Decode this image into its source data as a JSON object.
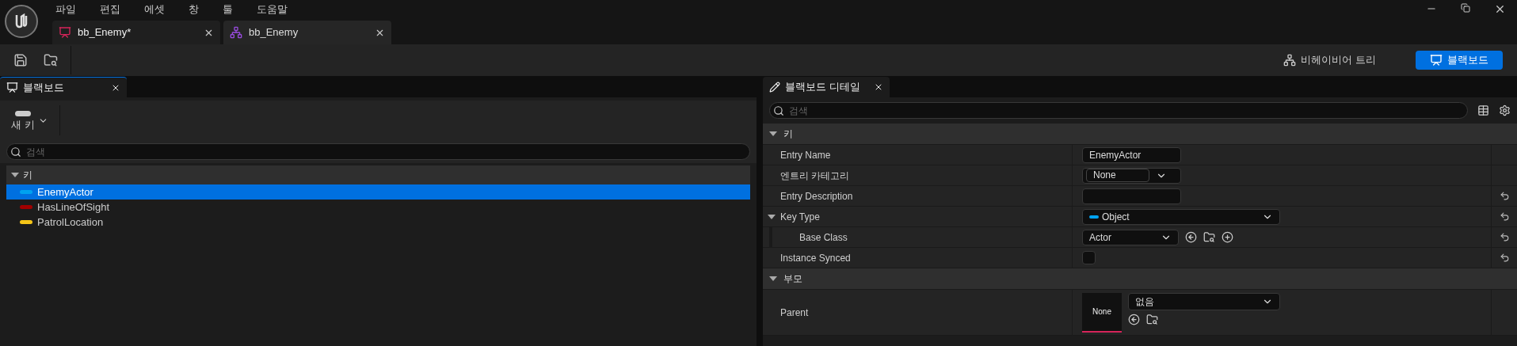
{
  "menu": [
    "파일",
    "편집",
    "에셋",
    "창",
    "툴",
    "도움말"
  ],
  "document_tabs": [
    {
      "label": "bb_Enemy*",
      "kind": "blackboard",
      "selected": true
    },
    {
      "label": "bb_Enemy",
      "kind": "behavior_tree",
      "selected": false
    }
  ],
  "modes": [
    {
      "label": "비헤이비어 트리",
      "kind": "behavior_tree",
      "selected": false
    },
    {
      "label": "블랙보드",
      "kind": "blackboard",
      "selected": true
    }
  ],
  "blackboard_panel": {
    "title": "블랙보드",
    "new_key": "새 키",
    "search": {
      "placeholder": "검색"
    },
    "category": "키",
    "keys": [
      {
        "name": "EnemyActor",
        "color": "#00a2f0",
        "selected": true
      },
      {
        "name": "HasLineOfSight",
        "color": "#a00000",
        "selected": false
      },
      {
        "name": "PatrolLocation",
        "color": "#f5c518",
        "selected": false
      }
    ]
  },
  "details_panel": {
    "title": "블랙보드 디테일",
    "search": {
      "placeholder": "검색"
    },
    "categories": [
      {
        "label": "키",
        "expanded": true,
        "rows": [
          {
            "label": "Entry Name",
            "kind": "text",
            "value": "EnemyActor",
            "reset": false
          },
          {
            "label": "엔트리 카테고리",
            "kind": "combo",
            "value": "None",
            "reset": false
          },
          {
            "label": "Entry Description",
            "kind": "text",
            "value": null,
            "reset": true
          },
          {
            "label": "Key Type",
            "kind": "type",
            "value": "Object",
            "color": "#00a2f0",
            "reset": true,
            "expanded": true,
            "children": [
              {
                "label": "Base Class",
                "kind": "class",
                "value": "Actor",
                "reset": true
              }
            ]
          },
          {
            "label": "Instance Synced",
            "kind": "checkbox",
            "checked": false,
            "reset": true
          }
        ]
      },
      {
        "label": "부모",
        "expanded": true,
        "rows": [
          {
            "label": "Parent",
            "kind": "parent",
            "thumb": "None",
            "value": "없음",
            "reset": false
          }
        ]
      }
    ]
  }
}
